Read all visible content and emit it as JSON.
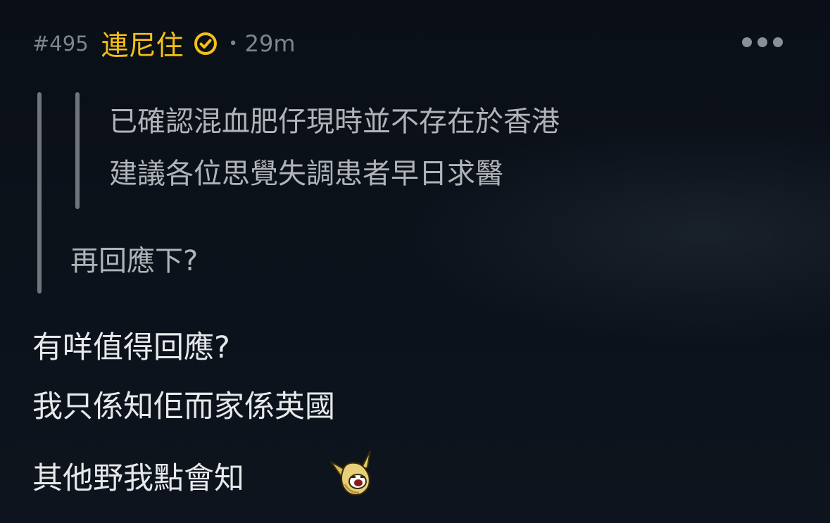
{
  "post": {
    "floor": "#495",
    "username": "連尼住",
    "verified_icon": "check-circle-icon",
    "separator": "•",
    "time": "29m",
    "more_icon": "more-horizontal-icon",
    "quote": {
      "nested_lines": [
        "已確認混血肥仔現時並不存在於香港",
        "建議各位思覺失調患者早日求醫"
      ],
      "line": "再回應下?"
    },
    "body_lines": [
      "有咩值得回應?",
      "我只係知佢而家係英國",
      "其他野我點會知"
    ],
    "sticker": "laughing-banana-sticker"
  },
  "colors": {
    "background": "#0b1018",
    "username": "#f5c015",
    "meta": "#7f858d",
    "quote_text": "#b0b4b8",
    "body_text": "#e6e8ea",
    "quote_bar": "#70757c"
  }
}
